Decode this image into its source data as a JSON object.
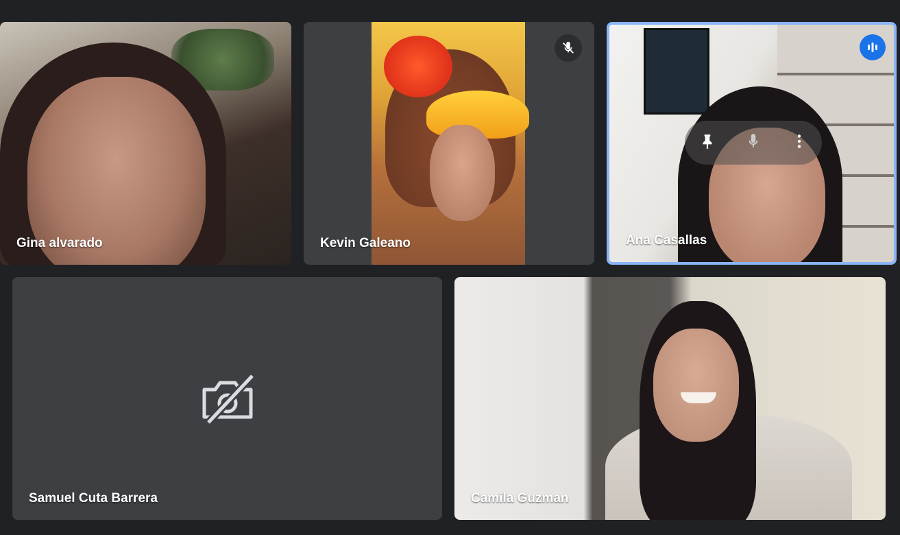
{
  "participants": [
    {
      "name": "Gina alvarado"
    },
    {
      "name": "Kevin Galeano",
      "muted": true
    },
    {
      "name": "Ana Casallas",
      "speaking": true,
      "hover_controls": [
        "pin-icon",
        "mic-icon",
        "more-vert-icon"
      ]
    },
    {
      "name": "Samuel Cuta Barrera",
      "camera_off": true
    },
    {
      "name": "Camila Guzman"
    }
  ],
  "colors": {
    "background": "#202124",
    "tile": "#3c4043",
    "active_border": "#8ab4f8",
    "speaking_badge": "#1a73e8"
  }
}
